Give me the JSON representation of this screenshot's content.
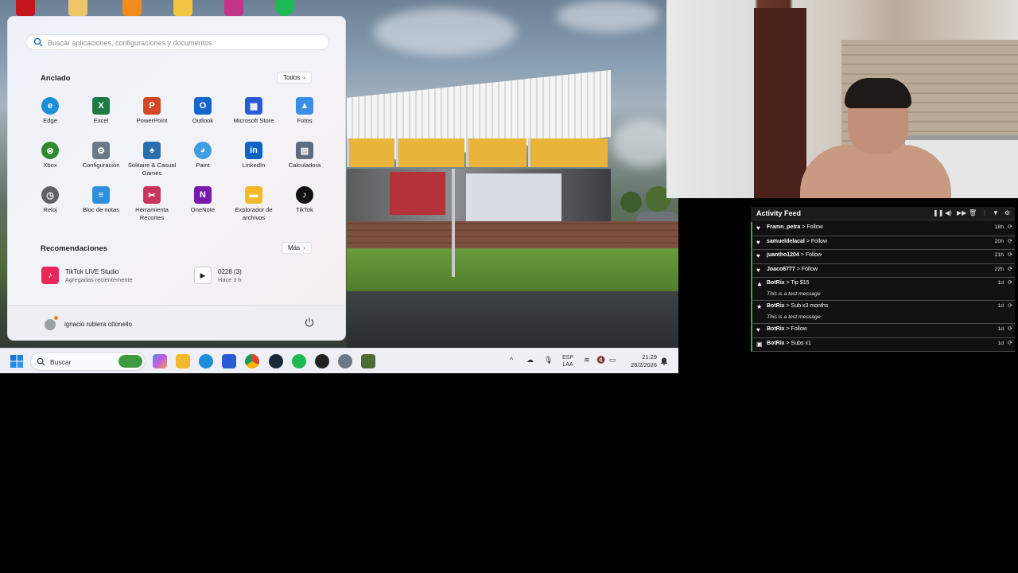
{
  "start_menu": {
    "search_placeholder": "Buscar aplicaciones, configuraciones y documentos",
    "pinned_title": "Anclado",
    "pinned_button": "Todos",
    "pinned_apps": [
      {
        "label": "Edge",
        "icon": "edge-icon",
        "color": "#1b8fd8"
      },
      {
        "label": "Excel",
        "icon": "excel-icon",
        "color": "#1e7b45"
      },
      {
        "label": "PowerPoint",
        "icon": "powerpoint-icon",
        "color": "#d24726"
      },
      {
        "label": "Outlook",
        "icon": "outlook-icon",
        "color": "#1467c9"
      },
      {
        "label": "Microsoft Store",
        "icon": "store-icon",
        "color": "#2a5bd7"
      },
      {
        "label": "Fotos",
        "icon": "photos-icon",
        "color": "#3a8ee6"
      },
      {
        "label": "Xbox",
        "icon": "xbox-icon",
        "color": "#2d8a2f"
      },
      {
        "label": "Configuración",
        "icon": "settings-icon",
        "color": "#6b7887"
      },
      {
        "label": "Solitaire & Casual Games",
        "icon": "solitaire-icon",
        "color": "#2a6fb0"
      },
      {
        "label": "Paint",
        "icon": "paint-icon",
        "color": "#3f9fe0"
      },
      {
        "label": "LinkedIn",
        "icon": "linkedin-icon",
        "color": "#0a66c2"
      },
      {
        "label": "Calculadora",
        "icon": "calculator-icon",
        "color": "#5b6d7e"
      },
      {
        "label": "Reloj",
        "icon": "clock-icon",
        "color": "#5e6166"
      },
      {
        "label": "Bloc de notas",
        "icon": "notepad-icon",
        "color": "#2f8fdb"
      },
      {
        "label": "Herramienta Recortes",
        "icon": "snipping-tool-icon",
        "color": "#c8365f"
      },
      {
        "label": "OneNote",
        "icon": "onenote-icon",
        "color": "#7719aa"
      },
      {
        "label": "Explorador de archivos",
        "icon": "file-explorer-icon",
        "color": "#f2b92c"
      },
      {
        "label": "TikTok",
        "icon": "tiktok-icon",
        "color": "#111111"
      }
    ],
    "recommended_title": "Recomendaciones",
    "recommended_button": "Más",
    "recommended": [
      {
        "name": "TikTok LIVE Studio",
        "sub": "Agregadas recientemente",
        "icon": "tiktok-live-studio-icon",
        "color": "#e8265a"
      },
      {
        "name": "0228 (3)",
        "sub": "Hace 3 h",
        "icon": "media-file-icon",
        "color": "#ffffff"
      }
    ],
    "user_name": "ignacio rubiera ottonello"
  },
  "taskbar": {
    "search_label": "Buscar",
    "lang_top": "ESP",
    "lang_bottom": "LAA",
    "time": "21:29",
    "date": "28/2/2026"
  },
  "activity_feed": {
    "title": "Activity Feed",
    "items": [
      {
        "user": "Framn_petra",
        "action": "Follow",
        "time": "18h",
        "icon": "heart-icon",
        "message": ""
      },
      {
        "user": "samueldelacal",
        "action": "Follow",
        "time": "20h",
        "icon": "heart-icon",
        "message": ""
      },
      {
        "user": "juantho1204",
        "action": "Follow",
        "time": "21h",
        "icon": "heart-icon",
        "message": ""
      },
      {
        "user": "Joaco6777",
        "action": "Follow",
        "time": "22h",
        "icon": "heart-icon",
        "message": ""
      },
      {
        "user": "BotRix",
        "action": "Tip $15",
        "time": "1d",
        "icon": "tip-icon",
        "message": "This is a test message"
      },
      {
        "user": "BotRix",
        "action": "Sub x3 months",
        "time": "1d",
        "icon": "star-icon",
        "message": "This is a test message"
      },
      {
        "user": "BotRix",
        "action": "Follow",
        "time": "1d",
        "icon": "heart-icon",
        "message": ""
      },
      {
        "user": "BotRix",
        "action": "Subs x1",
        "time": "1d",
        "icon": "gift-icon",
        "message": ""
      }
    ]
  }
}
